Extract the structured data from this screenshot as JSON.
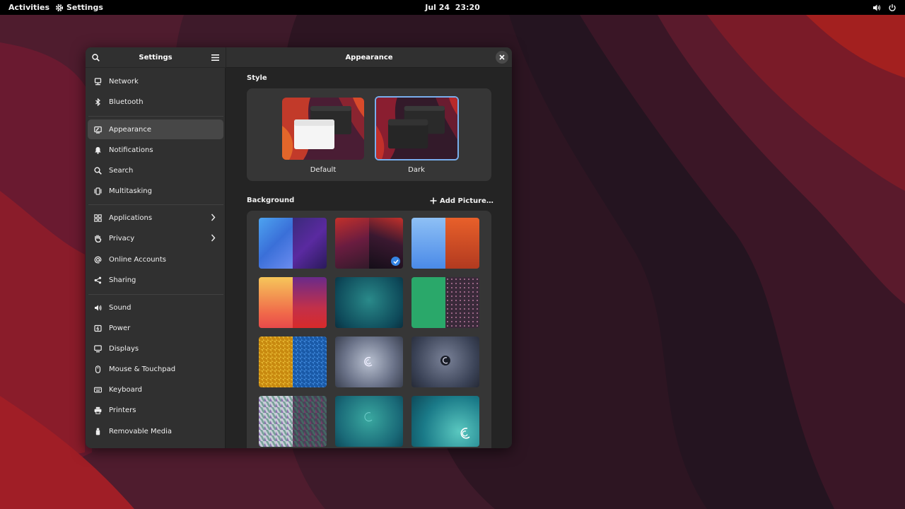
{
  "topbar": {
    "activities": "Activities",
    "app_name": "Settings",
    "date": "Jul 24",
    "time": "23:20",
    "app_icon": "gear-icon",
    "volume_icon": "volume-icon",
    "power_icon": "power-icon"
  },
  "sidebar": {
    "title": "Settings",
    "search_icon": "search-icon",
    "menu_icon": "hamburger-menu-icon",
    "items": [
      {
        "label": "Network",
        "icon": "network-icon"
      },
      {
        "label": "Bluetooth",
        "icon": "bluetooth-icon"
      },
      {
        "label": "Appearance",
        "icon": "appearance-icon",
        "selected": true
      },
      {
        "label": "Notifications",
        "icon": "bell-icon"
      },
      {
        "label": "Search",
        "icon": "search-icon"
      },
      {
        "label": "Multitasking",
        "icon": "multitasking-icon"
      },
      {
        "label": "Applications",
        "icon": "applications-icon",
        "has_submenu": true
      },
      {
        "label": "Privacy",
        "icon": "hand-icon",
        "has_submenu": true
      },
      {
        "label": "Online Accounts",
        "icon": "at-icon"
      },
      {
        "label": "Sharing",
        "icon": "share-icon"
      },
      {
        "label": "Sound",
        "icon": "speaker-icon"
      },
      {
        "label": "Power",
        "icon": "power-plug-icon"
      },
      {
        "label": "Displays",
        "icon": "display-icon"
      },
      {
        "label": "Mouse & Touchpad",
        "icon": "mouse-icon"
      },
      {
        "label": "Keyboard",
        "icon": "keyboard-icon"
      },
      {
        "label": "Printers",
        "icon": "printer-icon"
      },
      {
        "label": "Removable Media",
        "icon": "usb-icon"
      }
    ]
  },
  "content": {
    "title": "Appearance",
    "close_icon": "close-icon",
    "style": {
      "heading": "Style",
      "options": [
        {
          "label": "Default",
          "selected": false
        },
        {
          "label": "Dark",
          "selected": true
        }
      ]
    },
    "background": {
      "heading": "Background",
      "add_label": "Add Picture…",
      "add_icon": "plus-icon",
      "selected_index": 1
    }
  },
  "colors": {
    "accent": "#3584e4",
    "window_bg": "#242424",
    "sidebar_bg": "#303030",
    "topbar_bg": "#000000"
  }
}
